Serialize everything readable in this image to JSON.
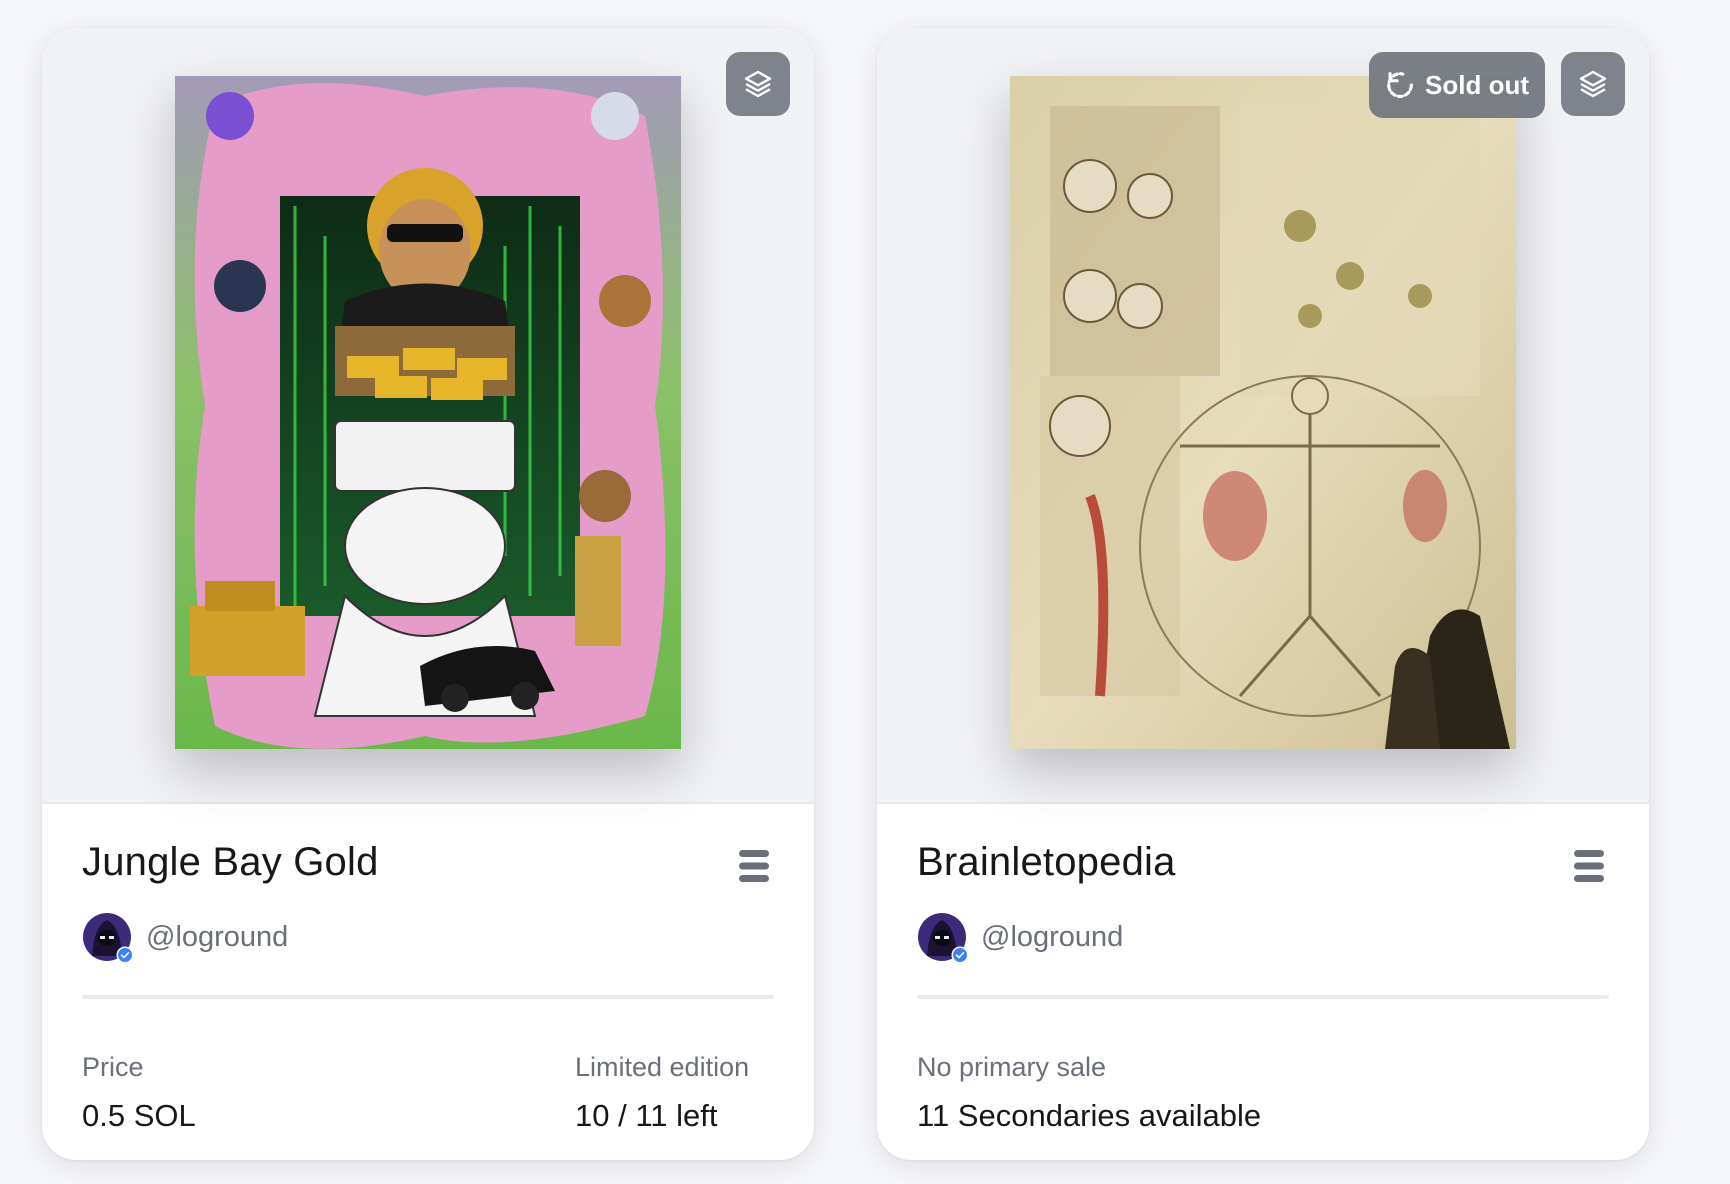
{
  "cards": [
    {
      "title": "Jungle Bay Gold",
      "creator_handle": "@loground",
      "media_icon": "layers-icon",
      "menu_icon": "menu-icon",
      "stats": {
        "price_label": "Price",
        "price_value": "0.5 SOL",
        "edition_label": "Limited edition",
        "edition_value": "10 / 11 left"
      }
    },
    {
      "title": "Brainletopedia",
      "creator_handle": "@loground",
      "badge": "Sold out",
      "badge_icon": "refresh-icon",
      "media_icon": "layers-icon",
      "menu_icon": "menu-icon",
      "stats": {
        "sale_label": "No primary sale",
        "sale_value": "11 Secondaries available"
      }
    }
  ],
  "colors": {
    "background": "#f6f7f9",
    "card": "#ffffff",
    "media_bg": "#f1f2f5",
    "text_primary": "#17181c",
    "text_secondary": "#6a6f79",
    "overlay_button": "#6e737c",
    "verified": "#3b82f6"
  }
}
